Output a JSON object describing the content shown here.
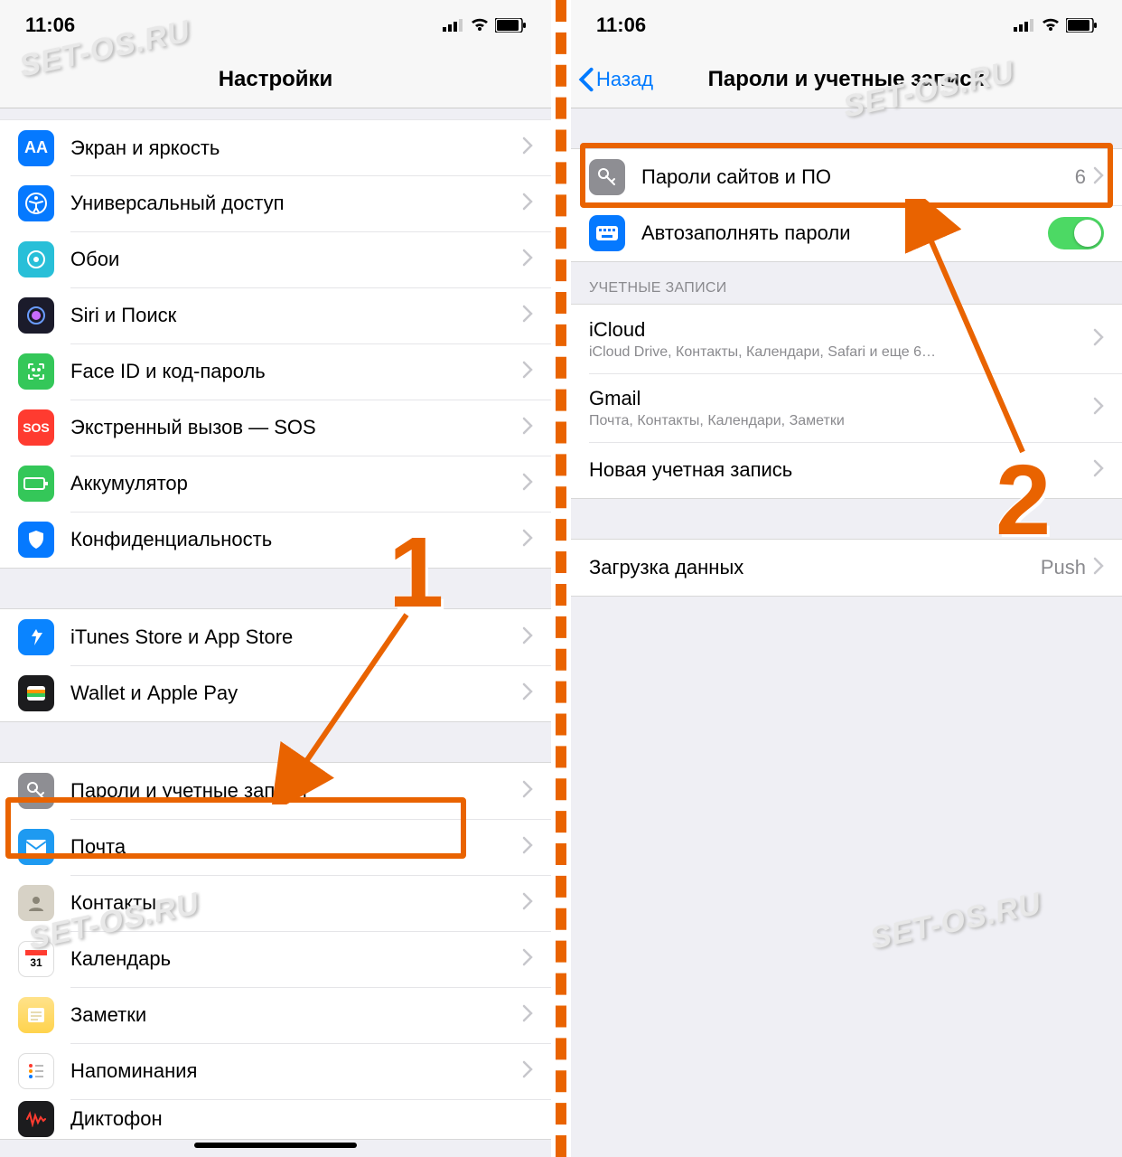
{
  "status": {
    "time": "11:06"
  },
  "watermark": "SET-OS.RU",
  "left": {
    "title": "Настройки",
    "group1": [
      {
        "label": "Экран и яркость"
      },
      {
        "label": "Универсальный доступ"
      },
      {
        "label": "Обои"
      },
      {
        "label": "Siri и Поиск"
      },
      {
        "label": "Face ID и код-пароль"
      },
      {
        "label": "Экстренный вызов — SOS"
      },
      {
        "label": "Аккумулятор"
      },
      {
        "label": "Конфиденциальность"
      }
    ],
    "group2": [
      {
        "label": "iTunes Store и App Store"
      },
      {
        "label": "Wallet и Apple Pay"
      }
    ],
    "group3": [
      {
        "label": "Пароли и учетные записи"
      },
      {
        "label": "Почта"
      },
      {
        "label": "Контакты"
      },
      {
        "label": "Календарь"
      },
      {
        "label": "Заметки"
      },
      {
        "label": "Напоминания"
      },
      {
        "label": "Диктофон"
      }
    ],
    "annotation": "1"
  },
  "right": {
    "back": "Назад",
    "title": "Пароли и учетные записи",
    "passwords": {
      "label": "Пароли сайтов и ПО",
      "count": "6"
    },
    "autofill": "Автозаполнять пароли",
    "section_accounts": "УЧЕТНЫЕ ЗАПИСИ",
    "accounts": [
      {
        "label": "iCloud",
        "sub": "iCloud Drive, Контакты, Календари, Safari и еще 6…"
      },
      {
        "label": "Gmail",
        "sub": "Почта, Контакты, Календари, Заметки"
      },
      {
        "label": "Новая учетная запись"
      }
    ],
    "fetch": {
      "label": "Загрузка данных",
      "value": "Push"
    },
    "annotation": "2"
  }
}
